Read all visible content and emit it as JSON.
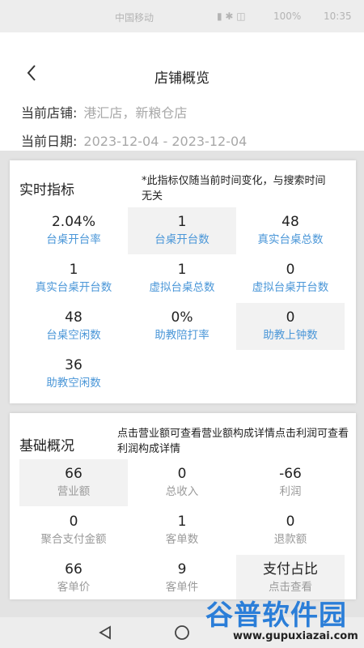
{
  "status_bar": {
    "carrier": "中国移动",
    "sys_text": "▮ ✱ ◫",
    "battery": "100%",
    "time": "10:35"
  },
  "header": {
    "title": "店铺概览",
    "store_label": "当前店铺:",
    "store_value": "港汇店，新粮仓店",
    "date_label": "当前日期:",
    "date_value": "2023-12-04 - 2023-12-04"
  },
  "realtime": {
    "title": "实时指标",
    "note": "*此指标仅随当前时间变化，与搜索时间无关",
    "metrics": [
      {
        "value": "2.04%",
        "label": "台桌开台率"
      },
      {
        "value": "1",
        "label": "台桌开台数"
      },
      {
        "value": "48",
        "label": "真实台桌总数"
      },
      {
        "value": "1",
        "label": "真实台桌开台数"
      },
      {
        "value": "1",
        "label": "虚拟台桌总数"
      },
      {
        "value": "0",
        "label": "虚拟台桌开台数"
      },
      {
        "value": "48",
        "label": "台桌空闲数"
      },
      {
        "value": "0%",
        "label": "助教陪打率"
      },
      {
        "value": "0",
        "label": "助教上钟数"
      },
      {
        "value": "36",
        "label": "助教空闲数"
      }
    ]
  },
  "basic": {
    "title": "基础概况",
    "note": "点击营业额可查看营业额构成详情点击利润可查看利润构成详情",
    "metrics": [
      {
        "value": "66",
        "label": "营业额"
      },
      {
        "value": "0",
        "label": "总收入"
      },
      {
        "value": "-66",
        "label": "利润"
      },
      {
        "value": "0",
        "label": "聚合支付金额"
      },
      {
        "value": "1",
        "label": "客单数"
      },
      {
        "value": "0",
        "label": "退款额"
      },
      {
        "value": "66",
        "label": "客单价"
      },
      {
        "value": "9",
        "label": "客单件"
      },
      {
        "value": "支付占比",
        "label": "点击查看"
      }
    ]
  },
  "watermark": {
    "logo": "谷普软件园",
    "url": "www.gupuxiazai.com"
  }
}
